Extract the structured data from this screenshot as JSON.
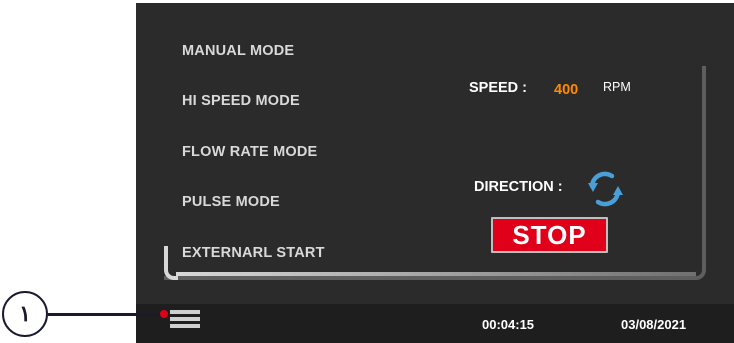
{
  "modes": [
    {
      "label": "MANUAL MODE"
    },
    {
      "label": "HI SPEED MODE"
    },
    {
      "label": "FLOW RATE MODE"
    },
    {
      "label": "PULSE MODE"
    },
    {
      "label": "EXTERNARL START"
    }
  ],
  "speed": {
    "label": "SPEED :",
    "value": "400",
    "unit": "RPM"
  },
  "direction": {
    "label": "DIRECTION :",
    "icon": "rotate-arrows-icon"
  },
  "stop_button": {
    "label": "STOP"
  },
  "status_bar": {
    "time": "00:04:15",
    "date": "03/08/2021",
    "menu_icon": "hamburger-menu-icon"
  },
  "callout": {
    "label": "١"
  },
  "colors": {
    "speed_value": "#ff8a00",
    "stop_bg": "#e1001a",
    "screen_bg": "#2b2b2b",
    "icon_blue": "#4a9fd8"
  }
}
